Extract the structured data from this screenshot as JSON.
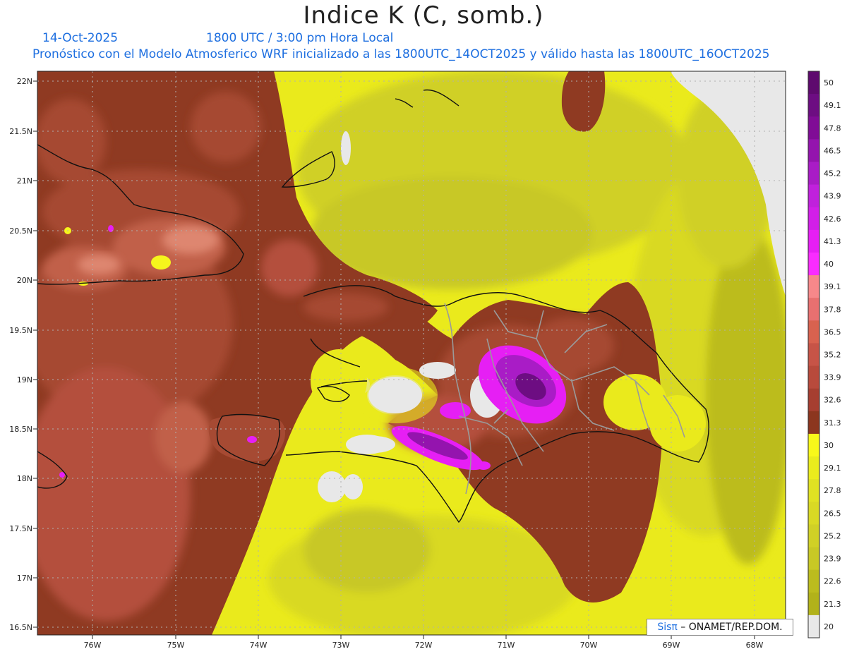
{
  "header": {
    "title": "Indice K (C, somb.)",
    "date": "14-Oct-2025",
    "time": "1800 UTC / 3:00 pm Hora Local",
    "description": "Pronóstico con el Modelo Atmosferico WRF inicializado a las 1800UTC_14OCT2025 y válido hasta las  1800UTC_16OCT2025"
  },
  "map": {
    "lat_labels": [
      "22N",
      "21.5N",
      "21N",
      "20.5N",
      "20N",
      "19.5N",
      "19N",
      "18.5N",
      "18N",
      "17.5N",
      "17N",
      "16.5N"
    ],
    "lon_labels": [
      "76W",
      "75W",
      "74W",
      "73W",
      "72W",
      "71W",
      "70W",
      "69W",
      "68W"
    ]
  },
  "legend": {
    "levels": [
      "50",
      "49.1",
      "47.8",
      "46.5",
      "45.2",
      "43.9",
      "42.6",
      "41.3",
      "40",
      "39.1",
      "37.8",
      "36.5",
      "35.2",
      "33.9",
      "32.6",
      "31.3",
      "30",
      "29.1",
      "27.8",
      "26.5",
      "25.2",
      "23.9",
      "22.6",
      "21.3",
      "20"
    ],
    "colors": [
      "#5e0a6e",
      "#6d0d82",
      "#800c96",
      "#9414ae",
      "#a91cc6",
      "#c021dc",
      "#d21fe8",
      "#e61ff4",
      "#f92cff",
      "#f7888a",
      "#e87070",
      "#d8624f",
      "#c75447",
      "#b84a3c",
      "#a63e30",
      "#8c361f",
      "#f8f81a",
      "#eaec1d",
      "#e0e223",
      "#d9d924",
      "#d0d026",
      "#c8c825",
      "#bcbc1e",
      "#b2b21a",
      "#e8e8e8"
    ]
  },
  "credit": {
    "sis": "Sisπ",
    "org": " – ONAMET/REP.DOM."
  }
}
